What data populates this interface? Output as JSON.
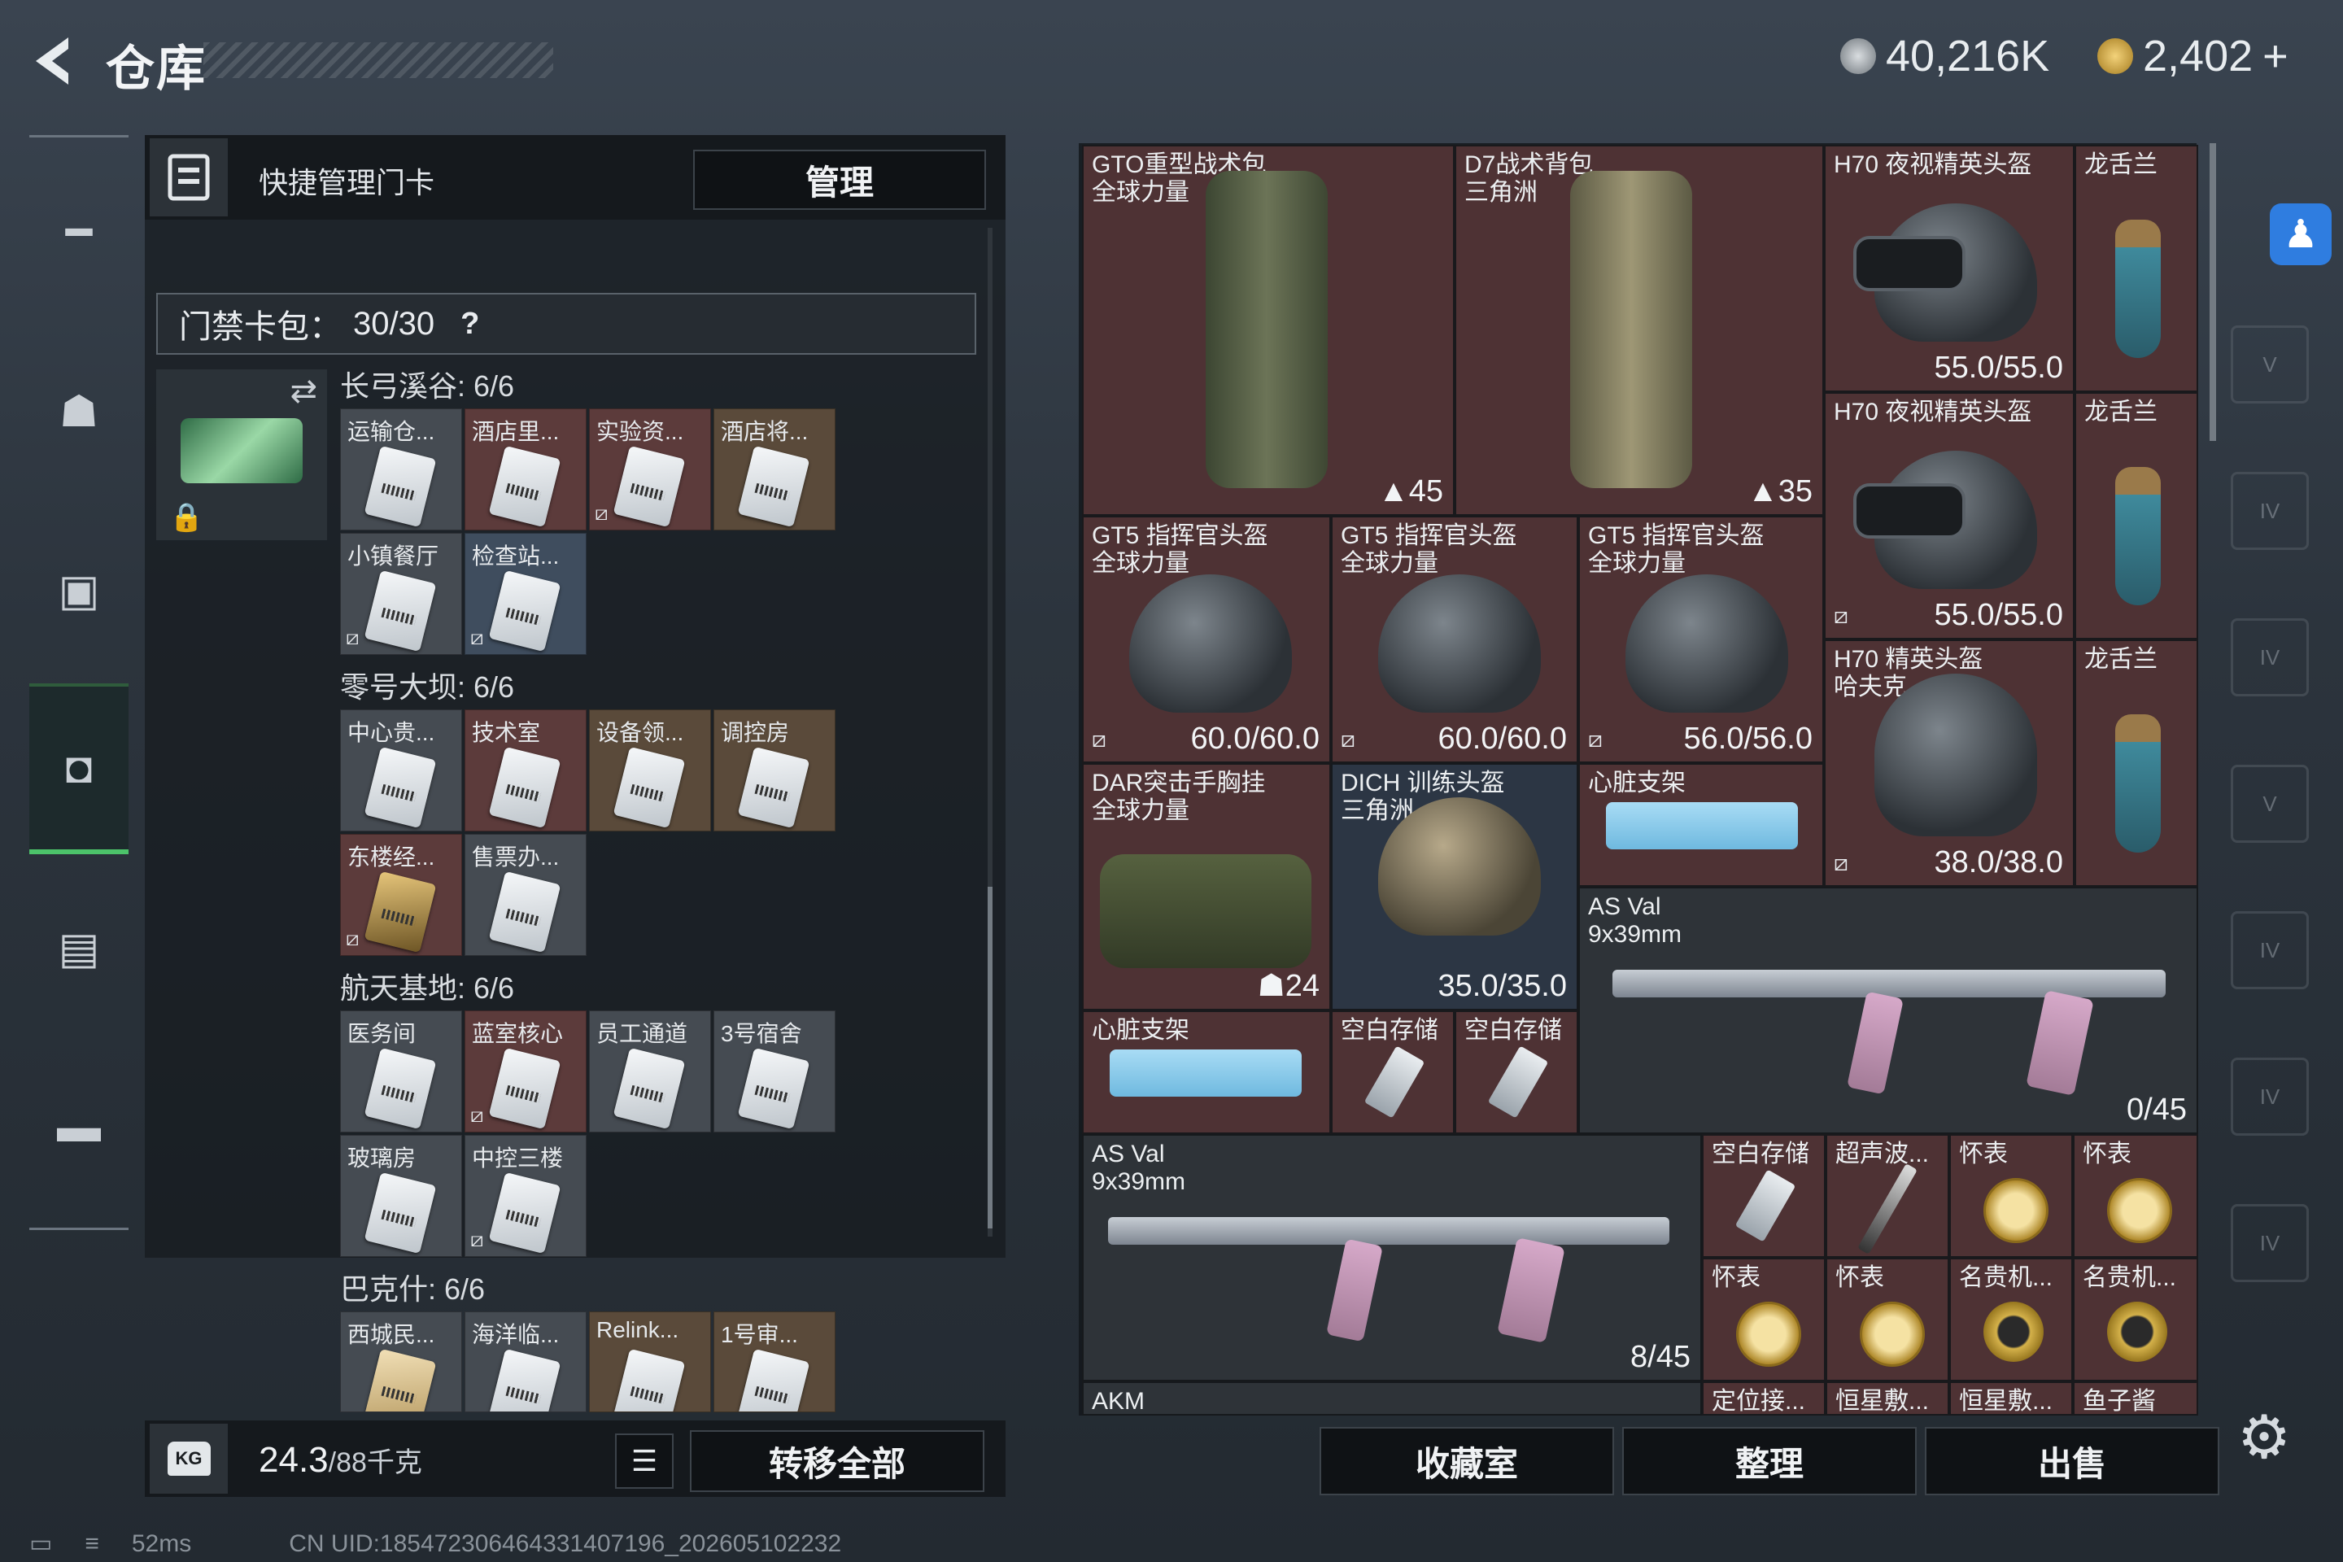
{
  "header": {
    "title": "仓库",
    "currency_1": "40,216K",
    "currency_2": "2,402",
    "currency_2_plus": "+"
  },
  "quick_bar": {
    "label": "快捷管理门卡",
    "manage_button": "管理"
  },
  "card_pack": {
    "label": "门禁卡包：",
    "count": "30/30",
    "help": "?"
  },
  "sections": [
    {
      "title": "长弓溪谷: 6/6",
      "cards": [
        "运输仓...",
        "酒店里...",
        "实验资...",
        "酒店将...",
        "小镇餐厅",
        "检查站..."
      ]
    },
    {
      "title": "零号大坝: 6/6",
      "cards": [
        "中心贵...",
        "技术室",
        "设备领...",
        "调控房",
        "东楼经...",
        "售票办..."
      ]
    },
    {
      "title": "航天基地: 6/6",
      "cards": [
        "医务间",
        "蓝室核心",
        "员工通道",
        "3号宿舍",
        "玻璃房",
        "中控三楼"
      ]
    },
    {
      "title": "巴克什: 6/6",
      "cards": [
        "西城民...",
        "海洋临...",
        "Relink...",
        "1号审..."
      ]
    }
  ],
  "bottom_left": {
    "weight": "24.3",
    "weight_unit": "/88千克",
    "weight_icon": "KG",
    "transfer_button": "转移全部"
  },
  "items": {
    "gto_bag": {
      "name_1": "GTO重型战术包",
      "name_2": "全球力量",
      "count": "45"
    },
    "d7_bag": {
      "name_1": "D7战术背包",
      "name_2": "三角洲",
      "count": "35"
    },
    "h70_a": {
      "name": "H70 夜视精英头盔",
      "dur": "55.0/55.0"
    },
    "h70_b": {
      "name": "H70 夜视精英头盔",
      "dur": "55.0/55.0"
    },
    "h70_c": {
      "name_1": "H70 精英头盔",
      "name_2": "哈夫克",
      "dur": "38.0/38.0"
    },
    "longshe": [
      "龙舌兰",
      "龙舌兰",
      "龙舌兰"
    ],
    "gt5": [
      {
        "name_1": "GT5 指挥官头盔",
        "name_2": "全球力量",
        "dur": "60.0/60.0"
      },
      {
        "name_1": "GT5 指挥官头盔",
        "name_2": "全球力量",
        "dur": "60.0/60.0"
      },
      {
        "name_1": "GT5 指挥官头盔",
        "name_2": "全球力量",
        "dur": "56.0/56.0"
      }
    ],
    "dar": {
      "name_1": "DAR突击手胸挂",
      "name_2": "全球力量",
      "count": "24"
    },
    "dich": {
      "name_1": "DICH 训练头盔",
      "name_2": "三角洲",
      "dur": "35.0/35.0"
    },
    "heart_1": "心脏支架",
    "heart_2": "心脏支架",
    "asval_1": {
      "name_1": "AS Val",
      "name_2": "9x39mm",
      "ammo": "0/45"
    },
    "asval_2": {
      "name_1": "AS Val",
      "name_2": "9x39mm",
      "ammo": "8/45"
    },
    "empty_1": "空白存储",
    "empty_2": "空白存储",
    "empty_3": "空白存储",
    "ultrasonic": "超声波...",
    "watches": [
      "怀表",
      "怀表",
      "怀表",
      "怀表"
    ],
    "gold_watches": [
      "名贵机...",
      "名贵机..."
    ],
    "bottom_partial": [
      "AKM",
      "定位接...",
      "恒星敷...",
      "恒星敷...",
      "鱼子酱"
    ]
  },
  "bottom_right": {
    "collection": "收藏室",
    "sort": "整理",
    "sell": "出售"
  },
  "status_bar": {
    "ping": "52ms",
    "uid": "CN UID:1854723064643314071​96_202605102232"
  },
  "icons": [
    "back-arrow-icon",
    "gun-icon",
    "armor-icon",
    "backpack-icon",
    "bag-icon",
    "keycard-icon",
    "briefcase-icon",
    "gear-icon",
    "accessibility-icon",
    "lock-icon",
    "swap-icon"
  ],
  "colors": {
    "active_tab": "#4cc36a",
    "slot_maroon": "#4e3234",
    "accessibility": "#2f7de0"
  }
}
